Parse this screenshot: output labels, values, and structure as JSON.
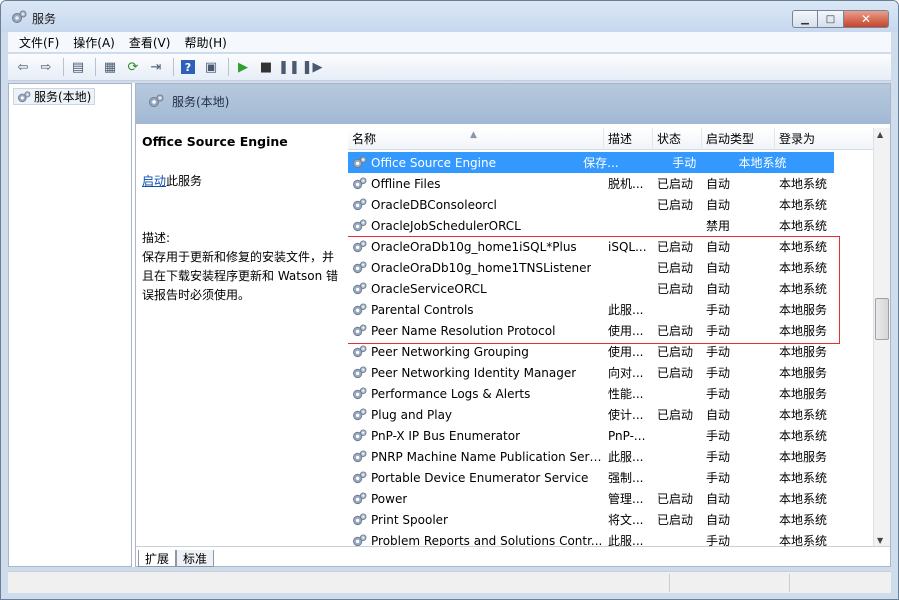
{
  "window": {
    "title": "服务"
  },
  "menu": [
    "文件(F)",
    "操作(A)",
    "查看(V)",
    "帮助(H)"
  ],
  "toolbar": {
    "icons": [
      "back-arrow-icon",
      "forward-arrow-icon",
      "console-tree-icon",
      "properties-icon",
      "refresh-icon",
      "export-icon",
      "help-icon",
      "show-hide-icon",
      "start-icon",
      "stop-icon",
      "pause-icon",
      "resume-icon"
    ]
  },
  "tree": {
    "node": "服务(本地)"
  },
  "pane": {
    "title": "服务(本地)"
  },
  "desc": {
    "title": "Office Source Engine",
    "start_link": "启动",
    "start_suffix": "此服务",
    "label": "描述:",
    "body": "保存用于更新和修复的安装文件，并且在下载安装程序更新和 Watson 错误报告时必须使用。"
  },
  "columns": [
    "名称",
    "描述",
    "状态",
    "启动类型",
    "登录为"
  ],
  "rows": [
    [
      "Office Source Engine",
      "保存...",
      "",
      "手动",
      "本地系统"
    ],
    [
      "Offline Files",
      "脱机...",
      "已启动",
      "自动",
      "本地系统"
    ],
    [
      "OracleDBConsoleorcl",
      "",
      "已启动",
      "自动",
      "本地系统"
    ],
    [
      "OracleJobSchedulerORCL",
      "",
      "",
      "禁用",
      "本地系统"
    ],
    [
      "OracleOraDb10g_home1iSQL*Plus",
      "iSQL...",
      "已启动",
      "自动",
      "本地系统"
    ],
    [
      "OracleOraDb10g_home1TNSListener",
      "",
      "已启动",
      "自动",
      "本地系统"
    ],
    [
      "OracleServiceORCL",
      "",
      "已启动",
      "自动",
      "本地系统"
    ],
    [
      "Parental Controls",
      "此服...",
      "",
      "手动",
      "本地服务"
    ],
    [
      "Peer Name Resolution Protocol",
      "使用...",
      "已启动",
      "手动",
      "本地服务"
    ],
    [
      "Peer Networking Grouping",
      "使用...",
      "已启动",
      "手动",
      "本地服务"
    ],
    [
      "Peer Networking Identity Manager",
      "向对...",
      "已启动",
      "手动",
      "本地服务"
    ],
    [
      "Performance Logs & Alerts",
      "性能...",
      "",
      "手动",
      "本地服务"
    ],
    [
      "Plug and Play",
      "使计...",
      "已启动",
      "自动",
      "本地系统"
    ],
    [
      "PnP-X IP Bus Enumerator",
      "PnP-...",
      "",
      "手动",
      "本地系统"
    ],
    [
      "PNRP Machine Name Publication Serv...",
      "此服...",
      "",
      "手动",
      "本地服务"
    ],
    [
      "Portable Device Enumerator Service",
      "强制...",
      "",
      "手动",
      "本地系统"
    ],
    [
      "Power",
      "管理...",
      "已启动",
      "自动",
      "本地系统"
    ],
    [
      "Print Spooler",
      "将文...",
      "已启动",
      "自动",
      "本地系统"
    ],
    [
      "Problem Reports and Solutions Contr...",
      "此服...",
      "",
      "手动",
      "本地系统"
    ]
  ],
  "tabs": [
    "扩展",
    "标准"
  ],
  "colors": {
    "selection": "#3399ff",
    "highlight_box": "#e03030",
    "link": "#0c4fb0"
  }
}
